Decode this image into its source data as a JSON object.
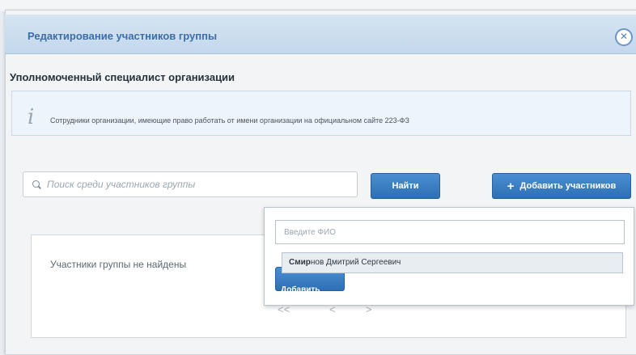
{
  "background_text": "",
  "dialog": {
    "title": "Редактирование участников группы",
    "close_icon": "close-icon"
  },
  "section": {
    "title": "Уполномоченный специалист организации"
  },
  "info": {
    "icon": "info-icon",
    "text": "Сотрудники организации, имеющие право работать от имени организации на официальном сайте 223-ФЗ"
  },
  "search": {
    "placeholder": "Поиск среди участников группы",
    "find_label": "Найти",
    "add_label": "Добавить участников"
  },
  "results": {
    "empty_text": "Участники группы не найдены",
    "pager": {
      "first": "<<",
      "prev": "<",
      "next": ">"
    }
  },
  "add_popup": {
    "input_placeholder": "Введите ФИО",
    "suggestion_match": "Смир",
    "suggestion_rest": "нов Дмитрий Сергеевич",
    "confirm_label": "Добавить"
  },
  "colors": {
    "accent": "#2d6fb4",
    "title_text": "#3a6ea5",
    "header_bg": "#c4d8ec"
  }
}
